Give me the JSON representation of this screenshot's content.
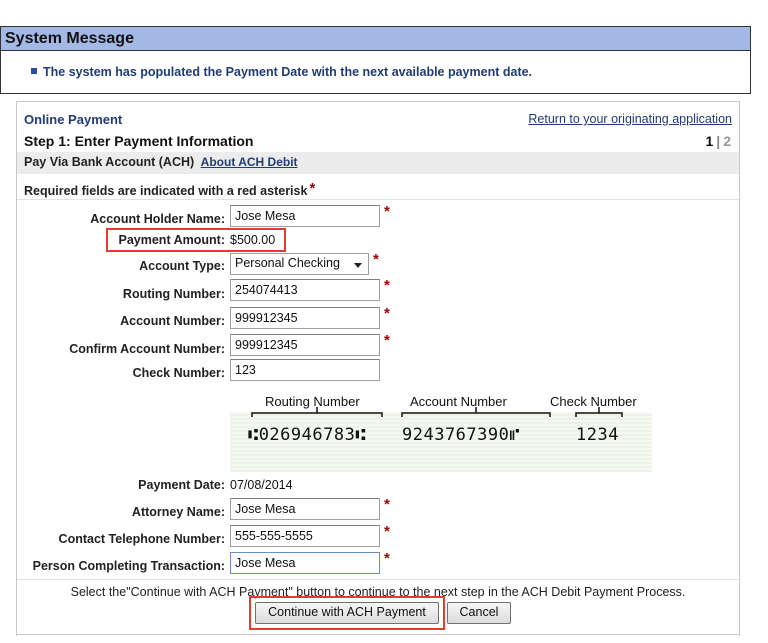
{
  "system_message": {
    "title": "System Message",
    "text": "The system has populated the Payment Date with the next available payment date."
  },
  "header": {
    "section": "Online Payment",
    "return_link": "Return to your originating application",
    "step_title": "Step 1: Enter Payment Information",
    "step_current": "1",
    "step_separator": "|",
    "step_next": "2"
  },
  "pay_via": {
    "label": "Pay Via Bank Account (ACH)",
    "about_link": "About ACH Debit"
  },
  "required_note": "Required fields are indicated with a red asterisk",
  "asterisk": "*",
  "fields": {
    "account_holder": {
      "label": "Account Holder Name:",
      "value": "Jose Mesa"
    },
    "payment_amount": {
      "label": "Payment Amount:",
      "value": "$500.00"
    },
    "account_type": {
      "label": "Account Type:",
      "value": "Personal Checking"
    },
    "routing_number": {
      "label": "Routing Number:",
      "value": "254074413"
    },
    "account_number": {
      "label": "Account Number:",
      "value": "999912345"
    },
    "confirm_account": {
      "label": "Confirm Account Number:",
      "value": "999912345"
    },
    "check_number": {
      "label": "Check Number:",
      "value": "123"
    },
    "payment_date": {
      "label": "Payment Date:",
      "value": "07/08/2014"
    },
    "attorney_name": {
      "label": "Attorney Name:",
      "value": "Jose Mesa"
    },
    "contact_phone": {
      "label": "Contact Telephone Number:",
      "value": "555-555-5555"
    },
    "person_completing": {
      "label": "Person Completing Transaction:",
      "value": "Jose Mesa"
    }
  },
  "check_image": {
    "routing_caption": "Routing Number",
    "account_caption": "Account Number",
    "check_caption": "Check Number",
    "micr_routing": "⑆026946783⑆",
    "micr_account": "9243767390⑈",
    "micr_check": "1234"
  },
  "instructions": "Select the\"Continue with ACH Payment\" button to continue to the next step in the ACH Debit Payment Process.",
  "buttons": {
    "continue": "Continue with ACH Payment",
    "cancel": "Cancel"
  },
  "colors": {
    "system_header": "#a4b8e6",
    "message_text": "#1f3c77",
    "asterisk": "#a00000",
    "highlight": "#e03c31"
  }
}
